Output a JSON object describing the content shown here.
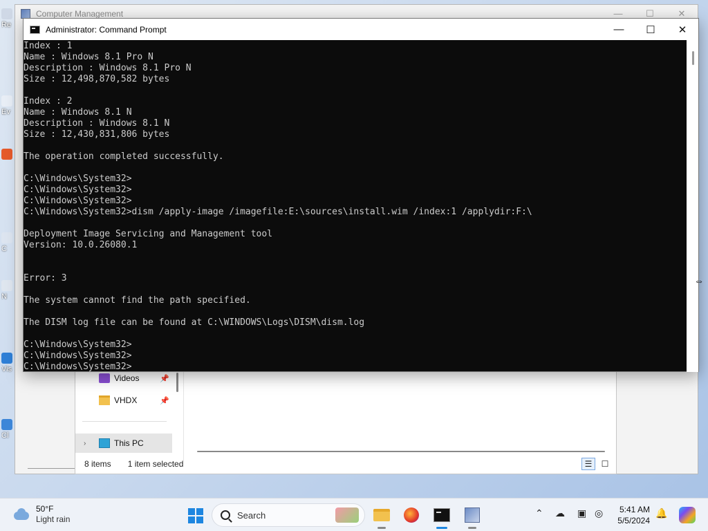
{
  "computer_management": {
    "title": "Computer Management"
  },
  "desktop_fragments": [
    "Re",
    "Ev",
    "C",
    "N",
    "Vis",
    "Cl"
  ],
  "file_explorer": {
    "nav_items": [
      {
        "label": "Videos",
        "icon": "videos-folder-icon"
      },
      {
        "label": "VHDX",
        "icon": "folder-icon"
      },
      {
        "label": "This PC",
        "icon": "computer-icon"
      }
    ],
    "status_count": "8 items",
    "status_selected": "1 item selected"
  },
  "cmd": {
    "title": "Administrator: Command Prompt",
    "lines": [
      "Index : 1",
      "Name : Windows 8.1 Pro N",
      "Description : Windows 8.1 Pro N",
      "Size : 12,498,870,582 bytes",
      "",
      "Index : 2",
      "Name : Windows 8.1 N",
      "Description : Windows 8.1 N",
      "Size : 12,430,831,806 bytes",
      "",
      "The operation completed successfully.",
      "",
      "C:\\Windows\\System32>",
      "C:\\Windows\\System32>",
      "C:\\Windows\\System32>",
      "C:\\Windows\\System32>dism /apply-image /imagefile:E:\\sources\\install.wim /index:1 /applydir:F:\\",
      "",
      "Deployment Image Servicing and Management tool",
      "Version: 10.0.26080.1",
      "",
      "",
      "Error: 3",
      "",
      "The system cannot find the path specified.",
      "",
      "The DISM log file can be found at C:\\WINDOWS\\Logs\\DISM\\dism.log",
      "",
      "C:\\Windows\\System32>",
      "C:\\Windows\\System32>",
      "C:\\Windows\\System32>"
    ]
  },
  "taskbar": {
    "weather_temp": "50°F",
    "weather_cond": "Light rain",
    "search_placeholder": "Search",
    "time": "5:41 AM",
    "date": "5/5/2024"
  }
}
